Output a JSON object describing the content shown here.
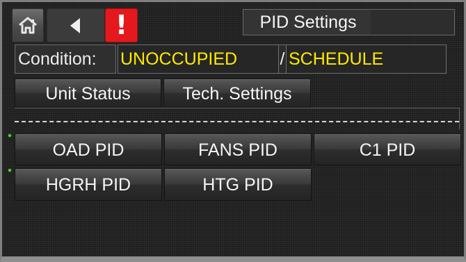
{
  "header": {
    "title": "PID Settings",
    "alert_symbol": "!"
  },
  "condition": {
    "label": "Condition:",
    "occupancy": "UNOCCUPIED",
    "separator": "/",
    "mode": "SCHEDULE"
  },
  "menu": {
    "unit_status": "Unit Status",
    "tech_settings": "Tech. Settings"
  },
  "pid_buttons": {
    "oad": "OAD PID",
    "fans": "FANS PID",
    "c1": "C1 PID",
    "hgrh": "HGRH PID",
    "htg": "HTG PID"
  },
  "colors": {
    "highlight_text": "#ffea00",
    "alert": "#e5191d",
    "screen_bg": "#1f1f1f",
    "status_dot": "#57d33d"
  },
  "icons": {
    "home": "home-icon",
    "back": "back-arrow-icon",
    "alert": "exclamation-icon"
  }
}
